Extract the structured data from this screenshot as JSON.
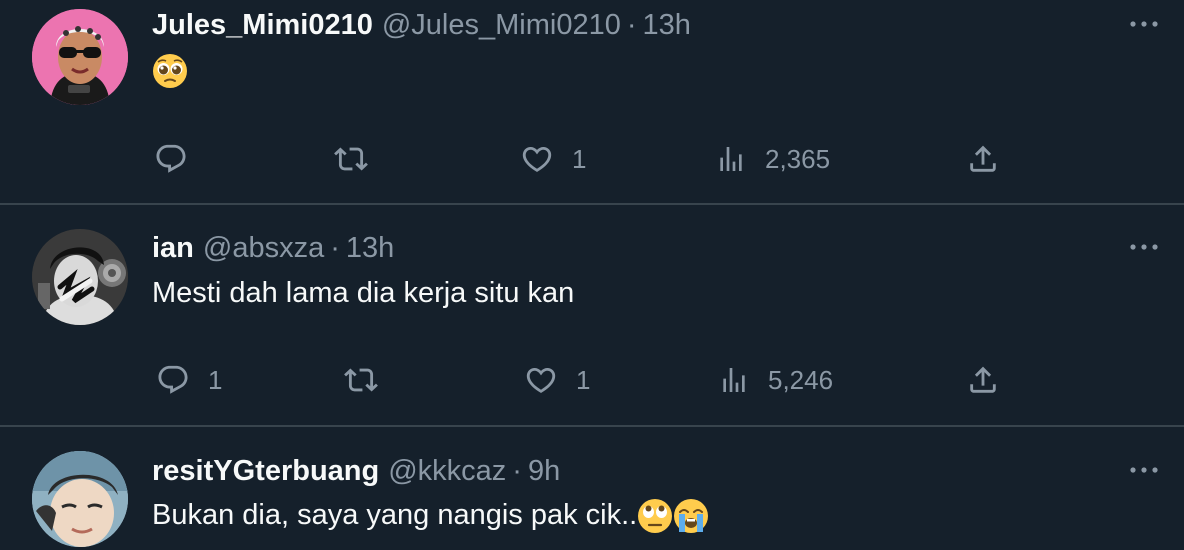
{
  "tweets": [
    {
      "name": "Jules_Mimi0210",
      "handle": "@Jules_Mimi0210",
      "separator": "·",
      "time": "13h",
      "text": "",
      "emoji": "pleading-face",
      "replies": "",
      "retweets": "",
      "likes": "1",
      "views": "2,365"
    },
    {
      "name": "ian",
      "handle": "@absxza",
      "separator": "·",
      "time": "13h",
      "text": "Mesti dah lama dia kerja situ kan",
      "replies": "1",
      "retweets": "",
      "likes": "1",
      "views": "5,246"
    },
    {
      "name": "resitYGterbuang",
      "handle": "@kkkcaz",
      "separator": "·",
      "time": "9h",
      "text": "Bukan dia, saya yang nangis pak cik..",
      "emojis": [
        "face-with-rolling-eyes",
        "loudly-crying-face"
      ]
    }
  ],
  "colors": {
    "background": "#15202b",
    "divider": "#38444d",
    "primary_text": "#f7f9f9",
    "secondary_text": "#8b98a5"
  }
}
